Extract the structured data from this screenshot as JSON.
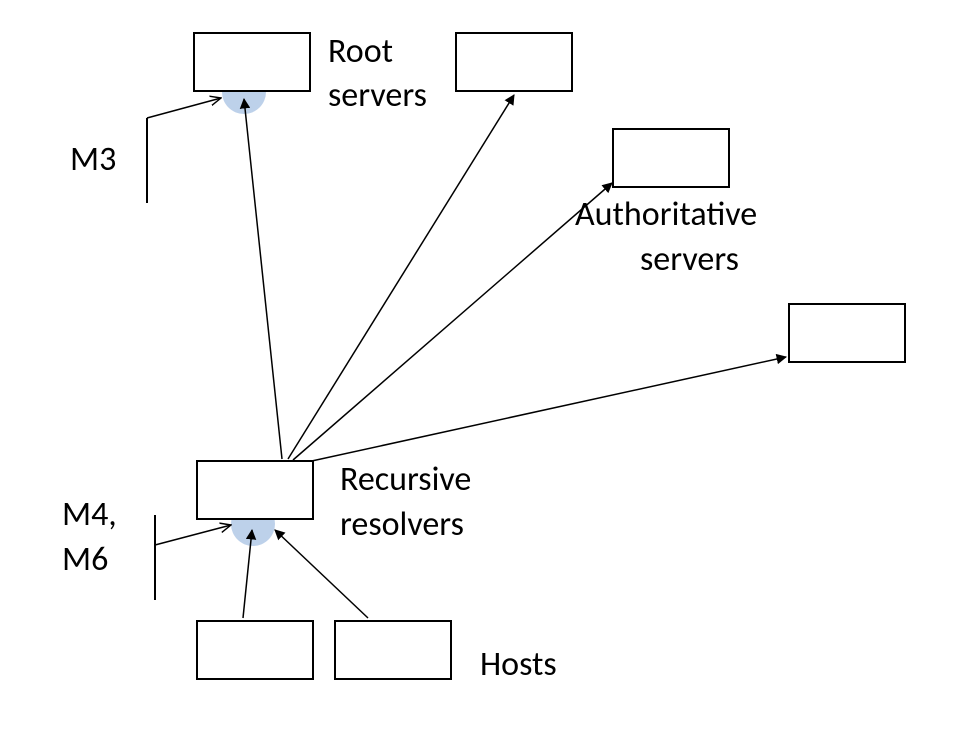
{
  "diagram": {
    "labels": {
      "m3": "M3",
      "m4m6_line1": "M4,",
      "m4m6_line2": "M6",
      "root_line1": "Root",
      "root_line2": "servers",
      "auth_line1": "Authoritative",
      "auth_line2": "servers",
      "recursive_line1": "Recursive",
      "recursive_line2": "resolvers",
      "hosts": "Hosts"
    },
    "nodes": {
      "root1": "root-server-left",
      "root2": "root-server-right",
      "auth1": "authoritative-server-top",
      "auth2": "authoritative-server-bottom",
      "resolver": "recursive-resolver",
      "host1": "host-left",
      "host2": "host-right"
    },
    "highlights": {
      "m3": "measurement-point-m3",
      "m4m6": "measurement-point-m4-m6"
    }
  }
}
